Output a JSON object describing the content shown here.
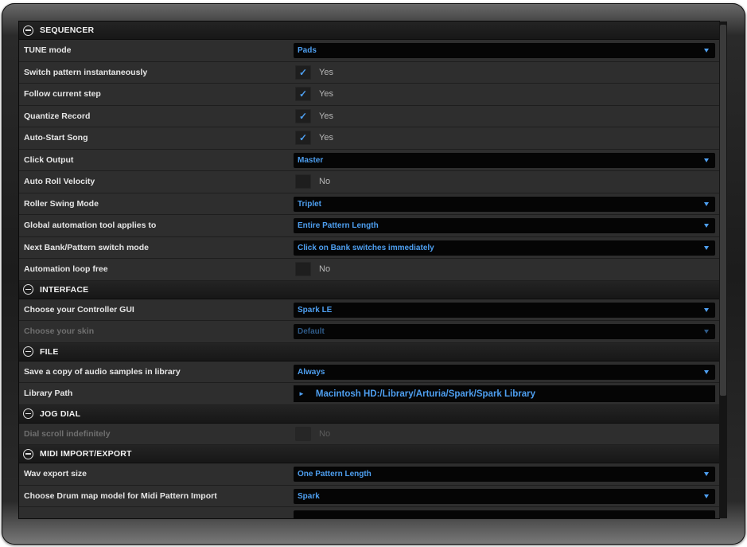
{
  "sections": {
    "sequencer": {
      "title": "SEQUENCER",
      "tune_mode": {
        "label": "TUNE mode",
        "value": "Pads"
      },
      "switch_pattern": {
        "label": "Switch pattern instantaneously",
        "value": "Yes",
        "checked": true
      },
      "follow_step": {
        "label": "Follow current step",
        "value": "Yes",
        "checked": true
      },
      "quantize_record": {
        "label": "Quantize Record",
        "value": "Yes",
        "checked": true
      },
      "auto_start": {
        "label": "Auto-Start Song",
        "value": "Yes",
        "checked": true
      },
      "click_output": {
        "label": "Click Output",
        "value": "Master"
      },
      "auto_roll_velocity": {
        "label": "Auto Roll Velocity",
        "value": "No",
        "checked": false
      },
      "roller_swing": {
        "label": "Roller Swing Mode",
        "value": "Triplet"
      },
      "global_automation": {
        "label": "Global automation tool applies to",
        "value": "Entire Pattern Length"
      },
      "next_bank": {
        "label": "Next Bank/Pattern switch mode",
        "value": "Click on Bank switches immediately"
      },
      "automation_loop": {
        "label": "Automation loop free",
        "value": "No",
        "checked": false
      }
    },
    "interface": {
      "title": "INTERFACE",
      "controller_gui": {
        "label": "Choose your Controller GUI",
        "value": "Spark LE"
      },
      "skin": {
        "label": "Choose your skin",
        "value": "Default"
      }
    },
    "file": {
      "title": "FILE",
      "save_copy": {
        "label": "Save a copy of audio samples in library",
        "value": "Always"
      },
      "library_path": {
        "label": "Library Path",
        "value": "Macintosh HD:/Library/Arturia/Spark/Spark Library"
      }
    },
    "jog_dial": {
      "title": "JOG DIAL",
      "dial_scroll": {
        "label": "Dial scroll indefinitely",
        "value": "No",
        "checked": false
      }
    },
    "midi": {
      "title": "MIDI IMPORT/EXPORT",
      "wav_export": {
        "label": "Wav export size",
        "value": "One Pattern Length"
      },
      "drum_map": {
        "label": "Choose Drum map model for Midi Pattern Import",
        "value": "Spark"
      }
    }
  },
  "icons": {
    "collapse": "minus-circle-icon",
    "check": "checkmark-icon",
    "dropdown": "triangle-down-icon"
  },
  "colors": {
    "accent": "#4e9ff0",
    "panel": "#2e2e2e",
    "field": "#050505"
  }
}
